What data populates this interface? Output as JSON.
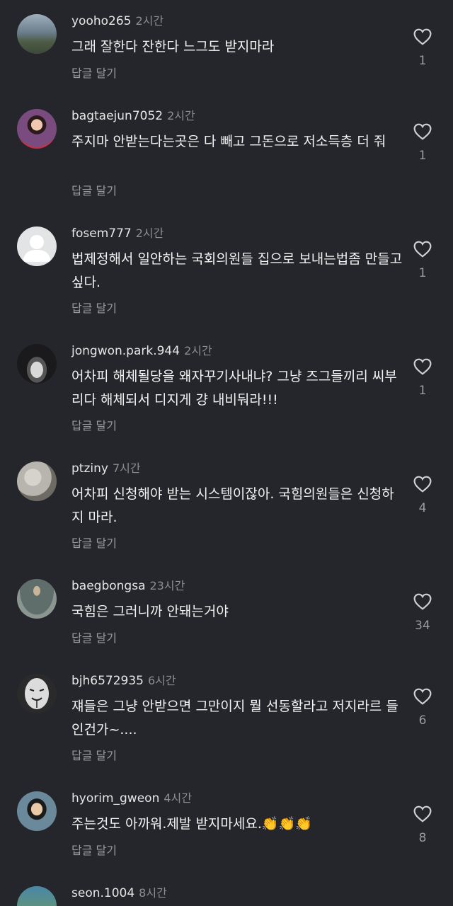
{
  "comments": [
    {
      "username": "yooho265",
      "time": "2시간",
      "text": "그래 잘한다 잔한다 느그도 받지마라",
      "reply_label": "답글 달기",
      "likes": "1",
      "avatar": "mountain-landscape-avatar",
      "avatar_colors": [
        "#6c7f8d",
        "#3d4a3a"
      ]
    },
    {
      "username": "bagtaejun7052",
      "time": "2시간",
      "text": "주지마 안받는다는곳은 다 빼고 그돈으로 저소득층 더 줘",
      "reply_label": "답글 달기",
      "likes": "1",
      "avatar": "illustrated-woman-avatar",
      "avatar_colors": [
        "#7a4b7e",
        "#c2324a"
      ]
    },
    {
      "username": "fosem777",
      "time": "2시간",
      "text": "법제정해서 일안하는 국회의원들 집으로 보내는법좀 만들고싶다.",
      "reply_label": "답글 달기",
      "likes": "1",
      "avatar": "default-person-avatar",
      "avatar_colors": [
        "#e3e4e6",
        "#ffffff"
      ]
    },
    {
      "username": "jongwon.park.944",
      "time": "2시간",
      "text": "어차피 해체될당을 왜자꾸기사내냐? 그냥 즈그들끼리 씨부리다 해체되서 디지게 걍 내비둬라!!!",
      "reply_label": "답글 달기",
      "likes": "1",
      "avatar": "car-at-night-avatar",
      "avatar_colors": [
        "#1a1a1c",
        "#c9c9c9"
      ]
    },
    {
      "username": "ptziny",
      "time": "7시간",
      "text": "어차피 신청해야 받는 시스템이잖아. 국힘의원들은 신청하지 마라.",
      "reply_label": "답글 달기",
      "likes": "4",
      "avatar": "blossom-tree-avatar",
      "avatar_colors": [
        "#b8b4ae",
        "#6e6a64"
      ]
    },
    {
      "username": "baegbongsa",
      "time": "23시간",
      "text": "국힘은  그러니까 안돼는거야",
      "reply_label": "답글 달기",
      "likes": "34",
      "avatar": "statue-figure-avatar",
      "avatar_colors": [
        "#5f6d6b",
        "#8a968f"
      ]
    },
    {
      "username": "bjh6572935",
      "time": "6시간",
      "text": "쟤들은 그냥 안받으면 그만이지 뭘 선동할라고 저지라르  들인건가~....",
      "reply_label": "답글 달기",
      "likes": "6",
      "avatar": "mask-face-avatar",
      "avatar_colors": [
        "#dcdcdc",
        "#2a2a2a"
      ]
    },
    {
      "username": "hyorim_gweon",
      "time": "4시간",
      "text": "주는것도 아까워.제발 받지마세요.👏👏👏",
      "reply_label": "답글 달기",
      "likes": "8",
      "avatar": "person-with-mask-avatar",
      "avatar_colors": [
        "#6a8a9c",
        "#1b1b1b"
      ]
    },
    {
      "username": "seon.1004",
      "time": "8시간",
      "text": "",
      "reply_label": "",
      "likes": "",
      "avatar": "stadium-avatar",
      "avatar_colors": [
        "#4a86a8",
        "#6f9c5a"
      ]
    }
  ],
  "icons": {
    "like": "heart-outline-icon"
  }
}
